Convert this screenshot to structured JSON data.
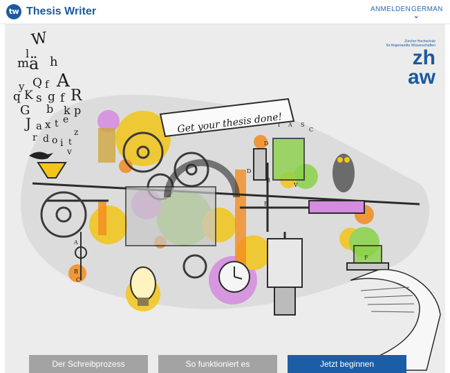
{
  "header": {
    "logo_text": "tw",
    "title": "Thesis Writer",
    "nav_login": "ANMELDEN",
    "nav_language": "GERMAN"
  },
  "hero": {
    "banner_text": "Get your thesis done!",
    "letters": [
      "W",
      "l",
      "m",
      "ä",
      "h",
      "y",
      "Q",
      "f",
      "A",
      "q",
      "K",
      "s",
      "g",
      "f",
      "R",
      "G",
      "b",
      "k",
      "p",
      "J",
      "a",
      "x",
      "t",
      "e",
      "r",
      "d",
      "o",
      "i",
      "t",
      "z",
      "v"
    ],
    "zhaw_small_line1": "Zürcher Hochschule",
    "zhaw_small_line2": "für Angewandte Wissenschaften",
    "zhaw_logo_line1": "zh",
    "zhaw_logo_line2": "aw",
    "diagram_labels": [
      "D",
      "I",
      "A",
      "S",
      "C",
      "B",
      "V",
      "E",
      "A",
      "B",
      "C",
      "D",
      "F"
    ]
  },
  "buttons": {
    "writing_process": "Der Schreibprozess",
    "how_it_works": "So funktioniert es",
    "start_now": "Jetzt beginnen"
  },
  "colors": {
    "brand_blue": "#1a5aa0",
    "button_grey": "#a3a3a3",
    "button_blue": "#1c5ea6",
    "accent_orange": "#f28c1f",
    "accent_green": "#8bd24a",
    "accent_yellow": "#f3c51a",
    "accent_pink": "#d58be0"
  }
}
